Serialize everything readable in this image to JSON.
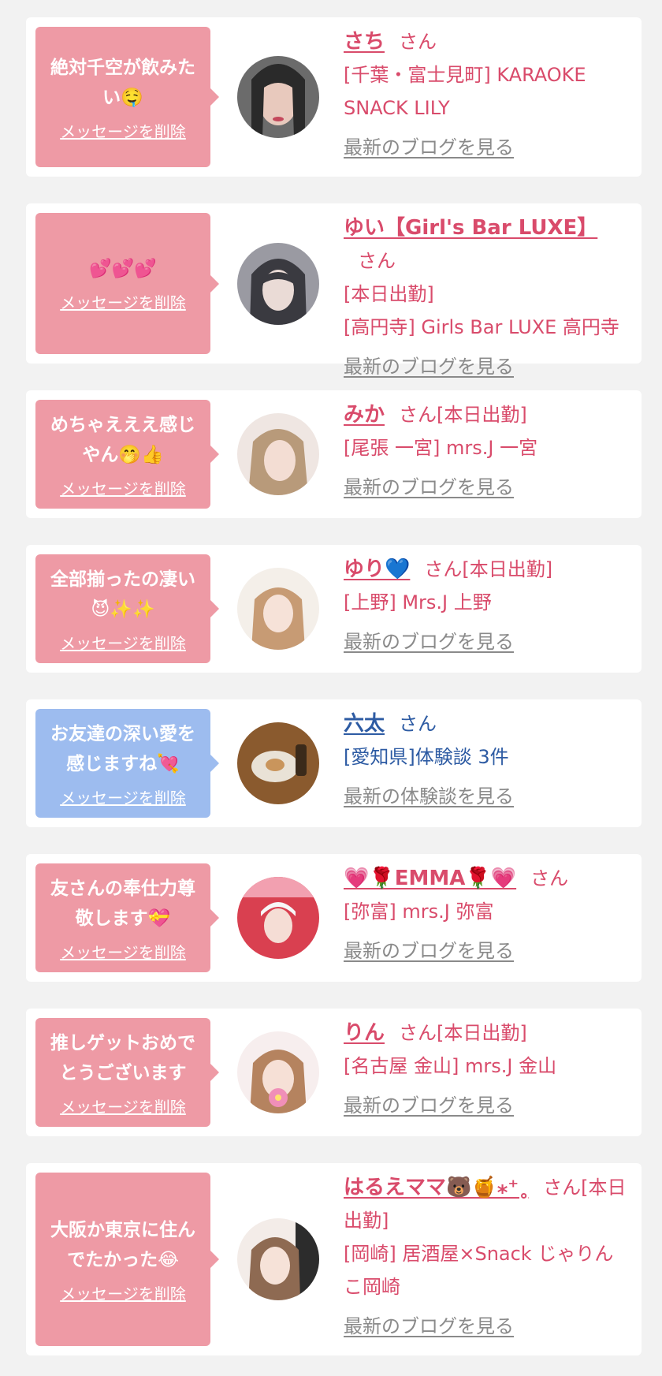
{
  "delete_label": "メッセージを削除",
  "colors": {
    "pink_bubble": "#ee9aa5",
    "blue_bubble": "#9dbcef",
    "pink_text": "#d94b6b",
    "blue_text": "#2d5ba3",
    "link_gray": "#8a8a8a"
  },
  "cards": [
    {
      "message": "絶対千空が飲みたい🤤",
      "name": "さち",
      "suffix": "さん",
      "lines": [
        "[千葉・富士見町] KARAOKE SNACK LILY"
      ],
      "more": "最新のブログを見る"
    },
    {
      "message": "💕💕💕",
      "name": "ゆい【Girl's Bar LUXE】",
      "suffix": "さん",
      "lines": [
        "[本日出勤]",
        "[高円寺] Girls Bar LUXE 高円寺"
      ],
      "more": "最新のブログを見る"
    },
    {
      "message": "めちゃえええ感じやん🤭👍",
      "name": "みか",
      "suffix": "さん[本日出勤]",
      "lines": [
        "[尾張 一宮] mrs.J 一宮"
      ],
      "more": "最新のブログを見る"
    },
    {
      "message": "全部揃ったの凄い😈✨✨",
      "name": "ゆり💙",
      "suffix": "さん[本日出勤]",
      "lines": [
        "[上野] Mrs.J 上野"
      ],
      "more": "最新のブログを見る"
    },
    {
      "message": "お友達の深い愛を感じますね💘",
      "name": "六太",
      "suffix": "さん",
      "lines": [
        "[愛知県]体験談 3件"
      ],
      "more": "最新の体験談を見る"
    },
    {
      "message": "友さんの奉仕力尊敬します💝",
      "name": "💗🌹EMMA🌹💗",
      "suffix": "さん",
      "lines": [
        "[弥富] mrs.J 弥富"
      ],
      "more": "最新のブログを見る"
    },
    {
      "message": "推しゲットおめでとうございます",
      "name": "りん",
      "suffix": "さん[本日出勤]",
      "lines": [
        "[名古屋 金山] mrs.J 金山"
      ],
      "more": "最新のブログを見る"
    },
    {
      "message": "大阪か東京に住んでたかった😂",
      "name": "はるえママ🐻🍯⁎⁺˳",
      "suffix": "さん[本日出勤]",
      "lines": [
        "[岡崎] 居酒屋×Snack じゃりんこ岡崎"
      ],
      "more": "最新のブログを見る"
    }
  ]
}
